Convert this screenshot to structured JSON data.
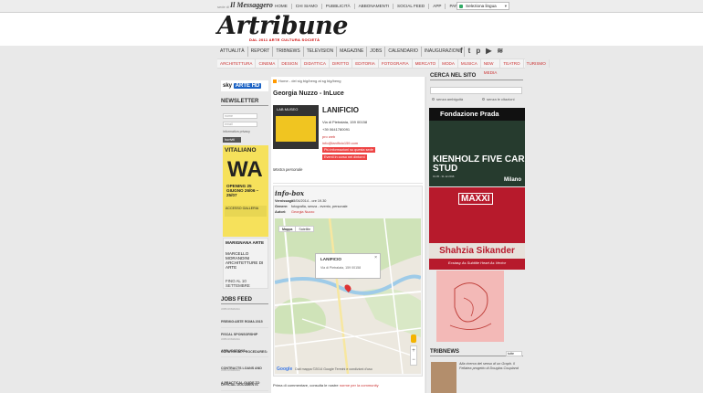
{
  "topbar": {
    "small_text": "sede di",
    "partner_logo": "Il Messaggero",
    "nav": [
      "HOME",
      "CHI SIAMO",
      "PUBBLICITÀ",
      "ABBONAMENTI",
      "SOCIAL FEED",
      "APP",
      "PARTNERS",
      "CONTATTI"
    ],
    "language_select": "Seleziona lingua"
  },
  "header": {
    "logo": "Artribune",
    "tagline": "DAL 2011 ARTE CULTURA SOCIETÀ"
  },
  "main_nav": [
    "ATTUALITÀ",
    "REPORT",
    "TRIBNEWS",
    "TELEVISION",
    "MAGAZINE",
    "JOBS",
    "CALENDARIO",
    "INAUGURAZIONI"
  ],
  "social_icons": [
    "facebook-icon",
    "twitter-icon",
    "pinterest-icon",
    "youtube-icon",
    "rss-icon"
  ],
  "social_glyphs": [
    "f",
    "t",
    "p",
    "▶",
    "≋"
  ],
  "category_nav": [
    "ARCHITETTURA",
    "CINEMA",
    "DESIGN",
    "DIDATTICA",
    "DIRITTO",
    "EDITORIA",
    "FOTOGRAFIA",
    "MERCATO",
    "MODA",
    "MUSICA",
    "NEW MEDIA",
    "TEATRO",
    "TURISMO"
  ],
  "left": {
    "sky_text": "sky",
    "sky_badge": "ARTE HD",
    "newsletter_title": "NEWSLETTER",
    "nome_placeholder": "nome",
    "email_placeholder": "email",
    "privacy_text": "informativa privacy",
    "submit_label": "Iscriviti",
    "ad_wa": {
      "title": "VITALIANO",
      "big": "WA",
      "opening": "OPENING 25 GIUGNO 26/06 – 25/07",
      "gallery": "ACCESSO GALLERIA"
    },
    "ad_marignana": {
      "title": "MARIGNANA ARTE",
      "artist": "MARCELLO MORANDINI ARCHITETTURE DI ARTE",
      "dates": "FINO AL 10 SETTEMBRE"
    },
    "jobs_title": "JOBS FEED",
    "jobs": [
      {
        "label": "JOBS ROMAGNA",
        "title": "PREMIO ARTE ROMA 2015"
      },
      {
        "label": "JOBS ROMAGNA",
        "title": "FISCAL SPONSORSHIP APPLICATIONS"
      },
      {
        "label": "JOBS ROMAGNA",
        "title": "CURATORIAL PROCEDURES: CONTRACTS LOANS AND OFFICIAL DOCUMENTS"
      },
      {
        "label": "JOBS ROMAGNA",
        "title": "A PRACTICAL GUIDE TO CURATING"
      }
    ]
  },
  "article": {
    "breadcrumb": "Home - del sig big/beng at sg big/beng",
    "title": "Georgia Nuzzo - InLuce",
    "thumb_label": "LAB MUSEO",
    "venue_name": "LANIFICIO",
    "address": "Via di Pietralata, 159 00158",
    "phone": "+39 0641780091",
    "info_link": "pro web",
    "email": "info@lanificio159.com",
    "pill_more": "Più informazioni su questa sede",
    "pill_events": "Eventi in corso nei dintorni",
    "description": "Mostra personale",
    "infobox_title": "info-box",
    "info_rows": [
      {
        "label": "Vernissage:",
        "value": "13/04/2014 - ore 19.30"
      },
      {
        "label": "Genere:",
        "value": "fotografia, senza - evento, personale"
      },
      {
        "label": "Autori:",
        "value": "Georgia Nuzzo"
      }
    ],
    "map": {
      "type_map": "Mappa",
      "type_sat": "Satellite",
      "popup_name": "LANIFICIO",
      "popup_addr": "Via di Pietralata, 159 00158",
      "footer_logo": "Google",
      "footer_text": "Dati mappa ©2014 Google   Termini e condizioni d'uso",
      "zoom_in": "+",
      "zoom_out": "−",
      "close": "×"
    },
    "comment_text": "Prima di commentare, consulta le nostre",
    "comment_link": "norme per la community"
  },
  "right": {
    "search_title": "CERCA NEL SITO",
    "search_opt1": "senza ambiguità",
    "search_opt2": "senza le citazioni",
    "ad_prada": {
      "header": "Fondazione Prada",
      "title": "KIENHOLZ FIVE CAR STUD",
      "dates": "19.05 - 31.12.2016",
      "city": "Milano"
    },
    "ad_maxxi": {
      "logo": "MAXXI",
      "artist": "Shahzia Sikander",
      "subtitle": "Ecstasy As Subtitle Heart As Vector"
    },
    "tribnews_title": "TRIBNEWS",
    "tribnews_select": "tutte",
    "tribnews_text": "Alla ricerca del senso di un Graph. Il Fellatea progetto di Douglas Coupland"
  },
  "colors": {
    "accent_red": "#cc3333",
    "prada_bg": "#263b2e",
    "maxxi_red": "#b71a2c",
    "wa_yellow": "#f6e15b"
  }
}
